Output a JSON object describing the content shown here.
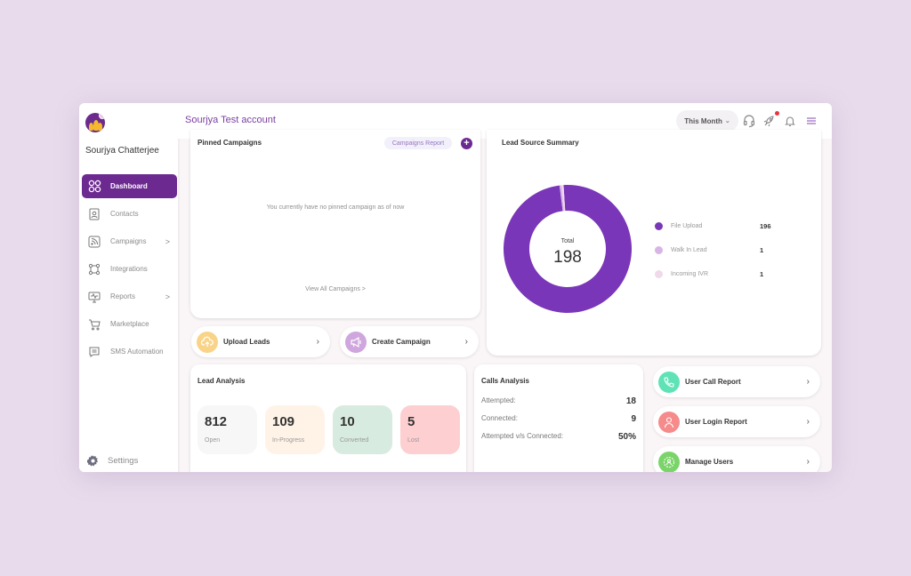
{
  "header": {
    "account_title": "Sourjya Test account",
    "period_selector": "This Month",
    "icons": [
      "headset-icon",
      "rocket-icon",
      "bell-icon",
      "menu-icon"
    ]
  },
  "sidebar": {
    "user_name": "Sourjya Chatterjee",
    "items": [
      {
        "label": "Dashboard",
        "icon": "grid-icon",
        "active": true
      },
      {
        "label": "Contacts",
        "icon": "contact-card-icon"
      },
      {
        "label": "Campaigns",
        "icon": "rss-icon",
        "has_submenu": true
      },
      {
        "label": "Integrations",
        "icon": "integrations-icon"
      },
      {
        "label": "Reports",
        "icon": "monitor-icon",
        "has_submenu": true
      },
      {
        "label": "Marketplace",
        "icon": "cart-icon"
      },
      {
        "label": "SMS Automation",
        "icon": "message-icon"
      }
    ],
    "settings_label": "Settings",
    "chevron": ">"
  },
  "pinned_campaigns": {
    "title": "Pinned Campaigns",
    "report_button": "Campaigns Report",
    "add_button": "+",
    "empty_message": "You currently have no pinned campaign as of now",
    "view_all": "View All Campaigns >"
  },
  "quick_actions": [
    {
      "label": "Upload Leads",
      "icon": "cloud-upload-icon",
      "color": "#f9d488"
    },
    {
      "label": "Create Campaign",
      "icon": "megaphone-icon",
      "color": "#cfa6dd"
    }
  ],
  "lead_source": {
    "title": "Lead Source Summary",
    "total_label": "Total",
    "total_value": "198"
  },
  "chart_data": {
    "type": "pie",
    "title": "Lead Source Summary",
    "categories": [
      "File Upload",
      "Walk In Lead",
      "Incoming IVR"
    ],
    "values": [
      196,
      1,
      1
    ],
    "colors": [
      "#7a36b8",
      "#d7b5e6",
      "#efd9ea"
    ],
    "total": 198,
    "legend": "right"
  },
  "lead_analysis": {
    "title": "Lead Analysis",
    "stats": [
      {
        "value": "812",
        "label": "Open",
        "bg": "#f8f7f8"
      },
      {
        "value": "109",
        "label": "In-Progress",
        "bg": "#fff3e8"
      },
      {
        "value": "10",
        "label": "Converted",
        "bg": "#d8ebe0"
      },
      {
        "value": "5",
        "label": "Lost",
        "bg": "#fdcfd1"
      }
    ]
  },
  "calls_analysis": {
    "title": "Calls Analysis",
    "rows": [
      {
        "key": "Attempted:",
        "value": "18"
      },
      {
        "key": "Connected:",
        "value": "9"
      },
      {
        "key": "Attempted v/s Connected:",
        "value": "50%"
      }
    ]
  },
  "report_links": [
    {
      "label": "User Call Report",
      "icon": "phone-icon",
      "color": "#5fe3b6"
    },
    {
      "label": "User Login Report",
      "icon": "user-icon",
      "color": "#f58b8b"
    },
    {
      "label": "Manage Users",
      "icon": "users-gear-icon",
      "color": "#7bd46a"
    }
  ],
  "colors": {
    "brand": "#6c2a91",
    "background": "#e8dcec",
    "notification": "#e8343f"
  }
}
